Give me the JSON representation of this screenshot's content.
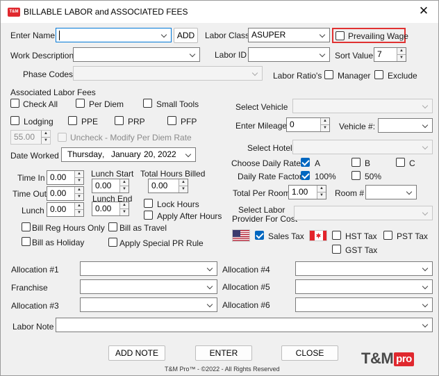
{
  "window": {
    "title": "BILLABLE LABOR and ASSOCIATED FEES",
    "icon_text": "T&M",
    "close_glyph": "✕"
  },
  "employee": {
    "enter_name_label": "Enter Name",
    "name_value": "",
    "add_label": "ADD",
    "labor_class_label": "Labor Class",
    "labor_class_value": "ASUPER",
    "prevailing_wage_label": "Prevailing Wage",
    "work_description_label": "Work Description",
    "work_description_value": "",
    "labor_id_label": "Labor ID",
    "labor_id_value": "",
    "sort_value_label": "Sort Value",
    "sort_value": "7",
    "phase_codes_label": "Phase Codes",
    "phase_codes_value": "",
    "labor_ratios_label": "Labor Ratio's",
    "manager_label": "Manager",
    "exclude_label": "Exclude"
  },
  "fees": {
    "heading": "Associated Labor Fees",
    "check_all": "Check All",
    "per_diem": "Per Diem",
    "small_tools": "Small Tools",
    "lodging": "Lodging",
    "ppe": "PPE",
    "prp": "PRP",
    "pfp": "PFP",
    "per_diem_amount": "55.00",
    "uncheck_label": "Uncheck - Modify Per Diem Rate"
  },
  "date": {
    "label": "Date Worked",
    "weekday": "Thursday",
    "sep": ",",
    "month": "January",
    "day_year": "20, 2022"
  },
  "hours": {
    "time_in_label": "Time In",
    "time_in": "0.00",
    "time_out_label": "Time Out",
    "time_out": "0.00",
    "lunch_label": "Lunch",
    "lunch": "0.00",
    "lunch_start_label": "Lunch Start",
    "lunch_start": "0.00",
    "lunch_end_label": "Lunch End",
    "lunch_end": "0.00",
    "total_billed_label": "Total Hours Billed",
    "total_billed": "0.00",
    "lock_hours": "Lock Hours",
    "apply_after_hours": "Apply After Hours",
    "bill_reg_hours_only": "Bill Reg Hours Only",
    "bill_as_travel": "Bill as Travel",
    "bill_as_holiday": "Bill as Holiday",
    "apply_special_pr_rule": "Apply Special PR Rule"
  },
  "vehicle": {
    "select_vehicle_label": "Select Vehicle",
    "vehicle_value": "",
    "enter_mileage_label": "Enter Mileage",
    "mileage": "0",
    "vehicle_num_label": "Vehicle #:",
    "vehicle_num_value": ""
  },
  "hotel": {
    "select_hotel_label": "Select Hotel",
    "hotel_value": "",
    "choose_daily_rate_label": "Choose Daily Rate",
    "rate_a": "A",
    "rate_b": "B",
    "rate_c": "C",
    "daily_rate_factor_label": "Daily Rate Factor",
    "factor_100": "100%",
    "factor_50": "50%",
    "total_per_room_label": "Total Per Room",
    "total_per_room": "1.00",
    "room_num_label": "Room #",
    "room_num_value": "",
    "provider_label_1": "Select Labor",
    "provider_label_2": "Provider For Cost",
    "provider_value": ""
  },
  "tax": {
    "sales_tax": "Sales Tax",
    "hst_tax": "HST Tax",
    "pst_tax": "PST Tax",
    "gst_tax": "GST Tax"
  },
  "allocations": {
    "a1": "Allocation #1",
    "a3": "Allocation #3",
    "a4": "Allocation #4",
    "a5": "Allocation #5",
    "a6": "Allocation #6",
    "franchise": "Franchise"
  },
  "labor_note": {
    "label": "Labor Note",
    "value": ""
  },
  "actions": {
    "add_note": "ADD NOTE",
    "enter": "ENTER",
    "close": "CLOSE"
  },
  "footer": {
    "copyright": "T&M Pro™ - ©2022 - All Rights Reserved",
    "logo_main": "T&M",
    "logo_pro": "pro"
  },
  "colors": {
    "checkbox_checked": "#0067c0",
    "highlight": "#e03131",
    "brand_red": "#e0282e"
  }
}
